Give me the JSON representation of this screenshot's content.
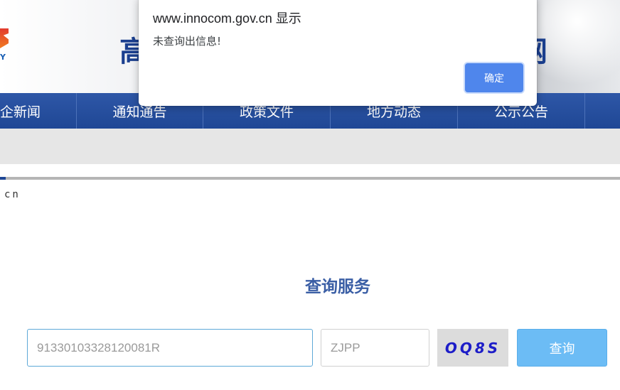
{
  "header": {
    "logo_letter": "Y",
    "title_left_fragment": "高",
    "title_right_fragment": "网"
  },
  "nav": {
    "items": [
      {
        "label": "企新闻"
      },
      {
        "label": "通知通告"
      },
      {
        "label": "政策文件"
      },
      {
        "label": "地方动态"
      },
      {
        "label": "公示公告"
      }
    ]
  },
  "site_fragment": "cn",
  "query": {
    "section_title": "查询服务",
    "id_value": "91330103328120081R",
    "code_value": "ZJPP",
    "captcha_text": "OQ8S",
    "submit_label": "查询"
  },
  "dialog": {
    "title": "www.innocom.gov.cn 显示",
    "message": "未查询出信息!",
    "ok_label": "确定"
  },
  "colors": {
    "nav_bg": "#2e57a7",
    "section_title": "#3a5ea5",
    "query_button": "#6cbcf5",
    "dialog_button": "#4f86ec",
    "captcha_text": "#1d1dc8"
  }
}
